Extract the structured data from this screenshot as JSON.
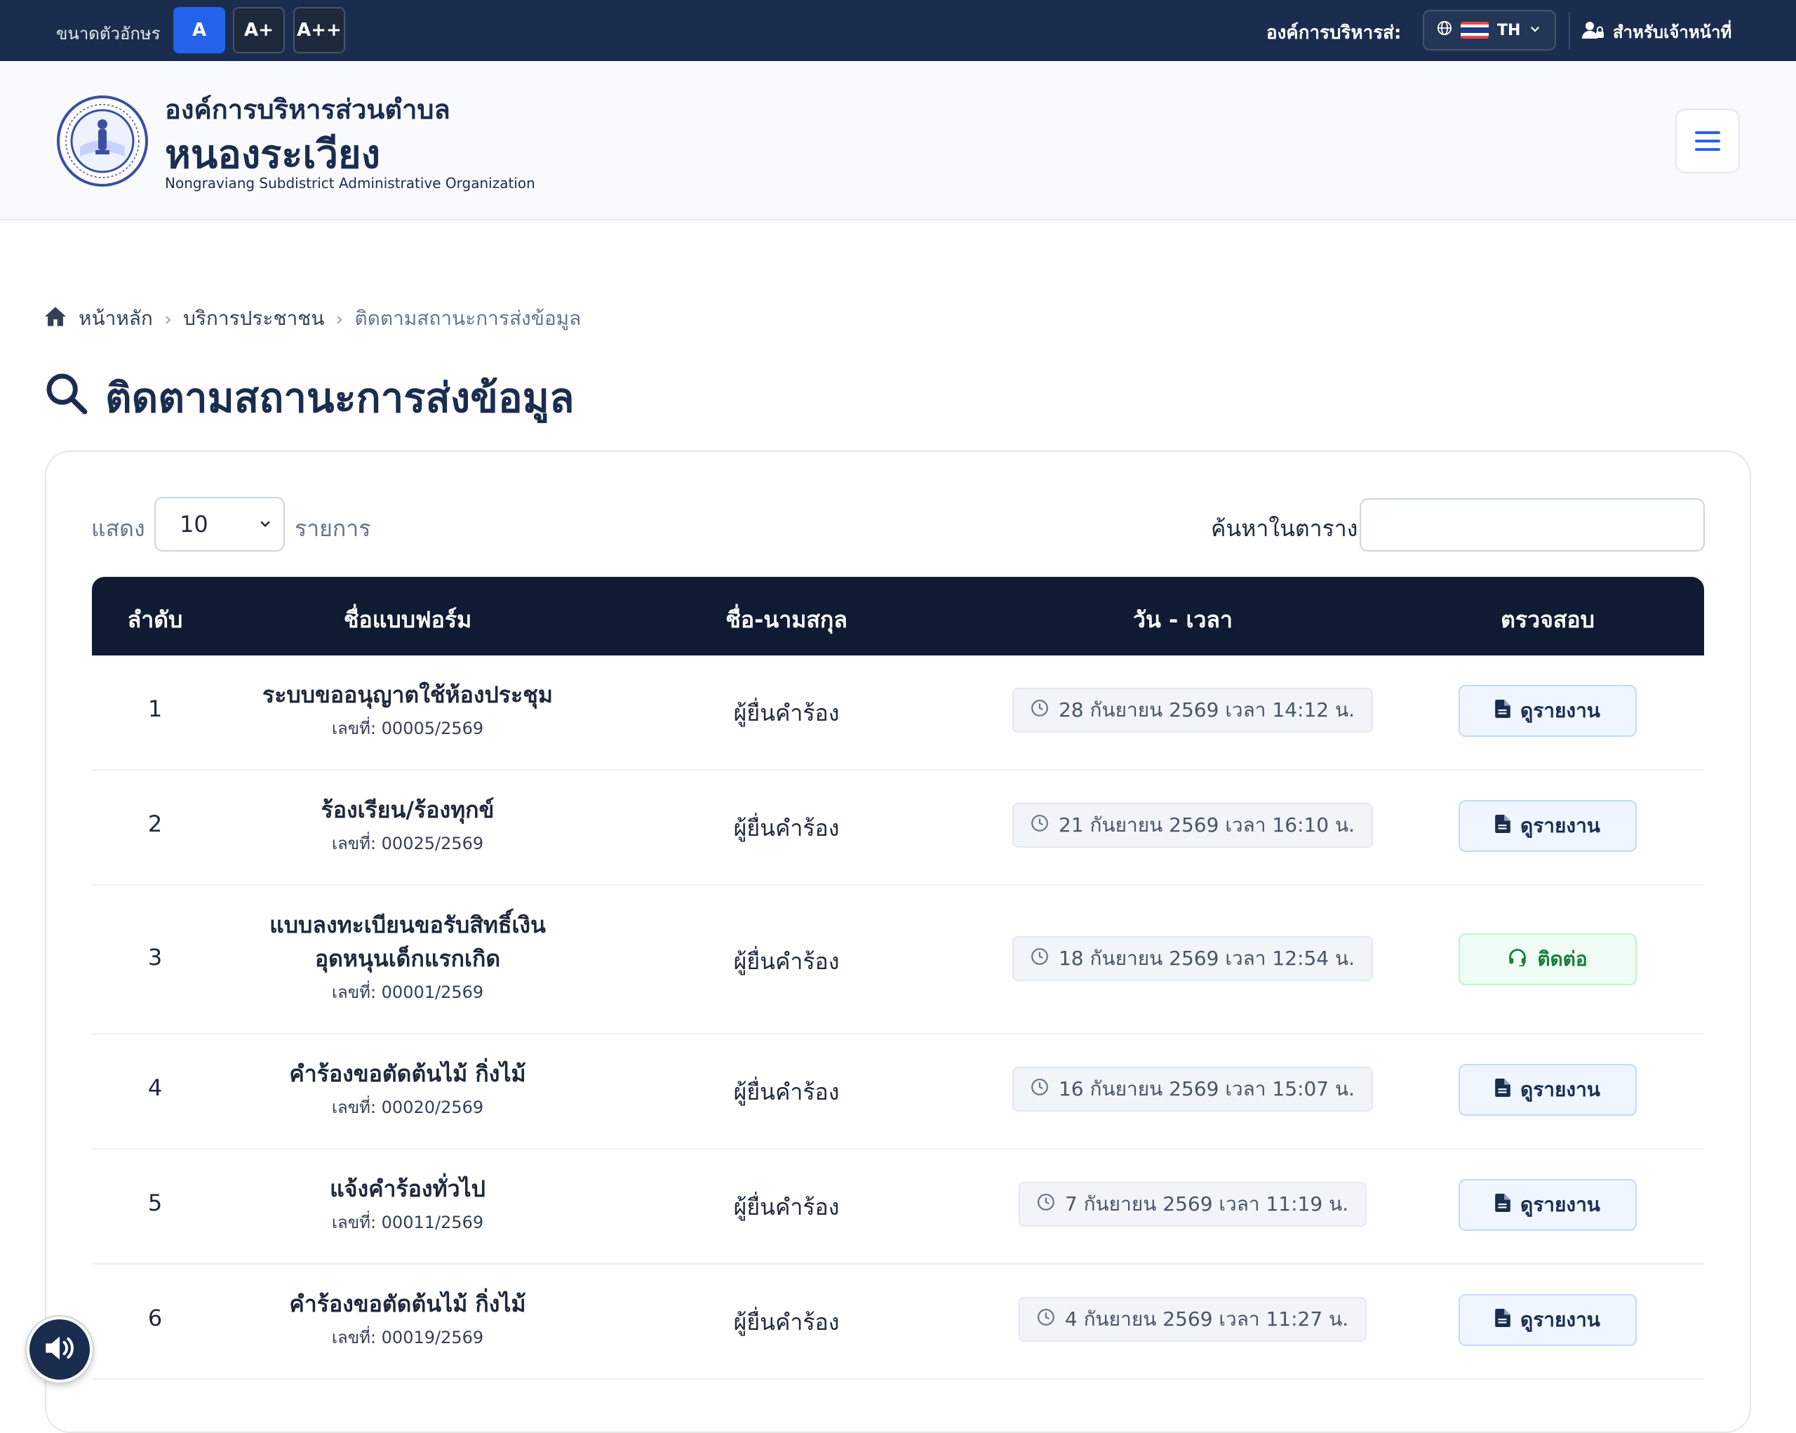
{
  "topbar": {
    "font_size_label": "ขนาดตัวอักษร",
    "font_sizes": [
      "A",
      "A+",
      "A++"
    ],
    "org_label": "องค์การบริหารส่:",
    "language": "TH",
    "staff_label": "สำหรับเจ้าหน้าที่"
  },
  "header": {
    "org_sub": "องค์การบริหารส่วนตำบล",
    "org_main": "หนองระเวียง",
    "org_en": "Nongraviang Subdistrict Administrative Organization"
  },
  "breadcrumb": {
    "home": "หน้าหลัก",
    "section": "บริการประชาชน",
    "current": "ติดตามสถานะการส่งข้อมูล"
  },
  "page_title": "ติดตามสถานะการส่งข้อมูล",
  "table_controls": {
    "show_label": "แสดง",
    "show_value": "10",
    "items_label": "รายการ",
    "search_label": "ค้นหาในตาราง:",
    "search_value": ""
  },
  "table": {
    "headers": [
      "ลำดับ",
      "ชื่อแบบฟอร์ม",
      "ชื่อ-นามสกุล",
      "วัน - เวลา",
      "ตรวจสอบ"
    ],
    "rows": [
      {
        "num": "1",
        "form": "ระบบขออนุญาตใช้ห้องประชุม",
        "form_no": "เลขที่: 00005/2569",
        "name": "ผู้ยื่นคำร้อง",
        "datetime": "28 กันยายน 2569 เวลา 14:12 น.",
        "action": "ดูรายงาน",
        "action_type": "report"
      },
      {
        "num": "2",
        "form": "ร้องเรียน/ร้องทุกข์",
        "form_no": "เลขที่: 00025/2569",
        "name": "ผู้ยื่นคำร้อง",
        "datetime": "21 กันยายน 2569 เวลา 16:10 น.",
        "action": "ดูรายงาน",
        "action_type": "report"
      },
      {
        "num": "3",
        "form": "แบบลงทะเบียนขอรับสิทธิ์เงิน อุดหนุนเด็กแรกเกิด",
        "form_no": "เลขที่: 00001/2569",
        "name": "ผู้ยื่นคำร้อง",
        "datetime": "18 กันยายน 2569 เวลา 12:54 น.",
        "action": "ติดต่อ",
        "action_type": "contact"
      },
      {
        "num": "4",
        "form": "คำร้องขอตัดต้นไม้ กิ่งไม้",
        "form_no": "เลขที่: 00020/2569",
        "name": "ผู้ยื่นคำร้อง",
        "datetime": "16 กันยายน 2569 เวลา 15:07 น.",
        "action": "ดูรายงาน",
        "action_type": "report"
      },
      {
        "num": "5",
        "form": "แจ้งคำร้องทั่วไป",
        "form_no": "เลขที่: 00011/2569",
        "name": "ผู้ยื่นคำร้อง",
        "datetime": "7 กันยายน 2569 เวลา 11:19 น.",
        "action": "ดูรายงาน",
        "action_type": "report"
      },
      {
        "num": "6",
        "form": "คำร้องขอตัดต้นไม้ กิ่งไม้",
        "form_no": "เลขที่: 00019/2569",
        "name": "ผู้ยื่นคำร้อง",
        "datetime": "4 กันยายน 2569 เวลา 11:27 น.",
        "action": "ดูรายงาน",
        "action_type": "report"
      }
    ]
  },
  "colors": {
    "navy": "#1b2d4f",
    "table_header": "#0f1b33",
    "accent_blue": "#2563eb",
    "contact_green": "#15803d"
  }
}
